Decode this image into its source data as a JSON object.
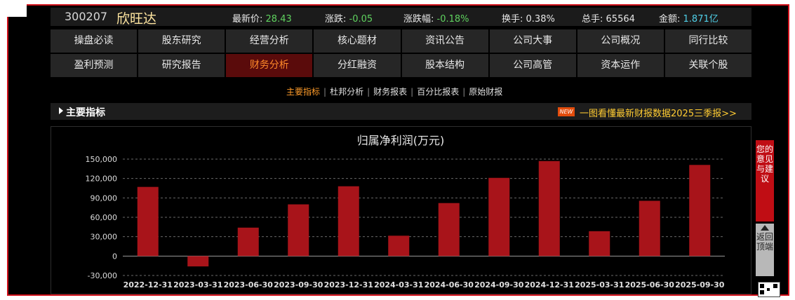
{
  "quote": {
    "code": "300207",
    "name": "欣旺达",
    "price_label": "最新价:",
    "price": "28.43",
    "change_label": "涨跌:",
    "change": "-0.05",
    "change_pct_label": "涨跌幅:",
    "change_pct": "-0.18%",
    "turnover_label": "换手:",
    "turnover": "0.38%",
    "volume_label": "总手:",
    "volume": "65564",
    "amount_label": "金额:",
    "amount": "1.871亿"
  },
  "nav_row1": [
    "操盘必读",
    "股东研究",
    "经营分析",
    "核心题材",
    "资讯公告",
    "公司大事",
    "公司概况",
    "同行比较"
  ],
  "nav_row2": [
    "盈利预测",
    "研究报告",
    "财务分析",
    "分红融资",
    "股本结构",
    "公司高管",
    "资本运作",
    "关联个股"
  ],
  "nav_active": "财务分析",
  "subnav": [
    "主要指标",
    "杜邦分析",
    "财务报表",
    "百分比报表",
    "原始财报"
  ],
  "subnav_active": "主要指标",
  "section": {
    "title": "主要指标",
    "new_tag": "NEW",
    "promo": "一图看懂最新财报数据2025三季报>>"
  },
  "side": {
    "feedback": "您的意见与建议",
    "back_top": "返回顶端"
  },
  "colors": {
    "bar": "#a8141a",
    "up": "#5fd35f",
    "amount": "#4fd0e8",
    "active_text": "#ff8a2a",
    "accent_red": "#c00d14"
  },
  "chart_data": {
    "type": "bar",
    "title": "归属净利润(万元)",
    "categories": [
      "2022-12-31",
      "2023-03-31",
      "2023-06-30",
      "2023-09-30",
      "2023-12-31",
      "2024-03-31",
      "2024-06-30",
      "2024-09-30",
      "2024-12-31",
      "2025-03-31",
      "2025-06-30",
      "2025-09-30"
    ],
    "values": [
      107000,
      -16000,
      44000,
      80000,
      108000,
      31500,
      82000,
      121000,
      147000,
      38500,
      85500,
      141000
    ],
    "yticks": [
      "150,000",
      "120,000",
      "90,000",
      "60,000",
      "30,000",
      "0",
      "-30,000"
    ],
    "ylim": [
      -30000,
      150000
    ],
    "grid": true
  }
}
